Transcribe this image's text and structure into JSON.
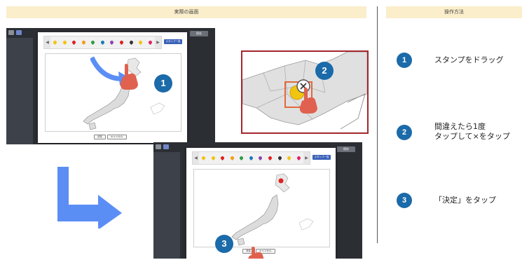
{
  "left_header": "実際の画面",
  "right_header": "操作方法",
  "screen": {
    "stamp_list_label": "スタンプ一覧",
    "save_label": "保存",
    "decide_label": "決定",
    "cancel_label": "キャンセル",
    "prev_arrow": "◀",
    "next_arrow": "▶"
  },
  "badges": {
    "one": "1",
    "two": "2",
    "three": "3"
  },
  "steps": [
    {
      "number": "1",
      "line1": "スタンプをドラッグ",
      "line2": ""
    },
    {
      "number": "2",
      "line1": "間違えたら1度",
      "line2": "タップして×をタップ"
    },
    {
      "number": "3",
      "line1": "「決定」をタップ",
      "line2": ""
    }
  ],
  "pin_colors": [
    "#f1c40f",
    "#f1c40f",
    "#e02020",
    "#f39c12",
    "#2e9e44",
    "#1a7abf",
    "#8e44ad",
    "#e02020",
    "#333333",
    "#f1c40f",
    "#e91e63"
  ],
  "colors": {
    "badge": "#1b6aa9",
    "header_bg": "#fbeecb",
    "zoom_border": "#a3272d",
    "arrow": "#5b8ef5",
    "hand": "#e0614f"
  }
}
